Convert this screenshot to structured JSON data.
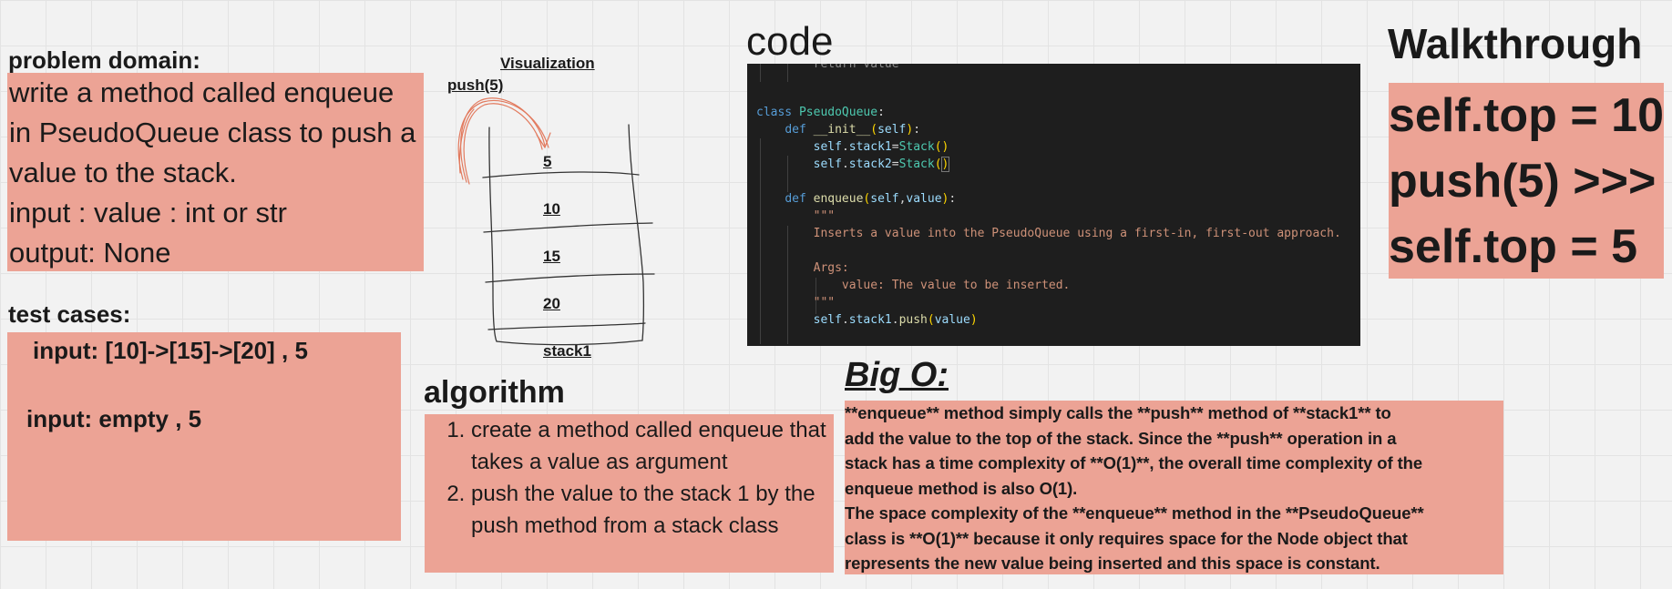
{
  "problem_domain": {
    "title": "problem domain:",
    "lines": [
      "write a method called enqueue",
      "in PseudoQueue class to push a",
      "value to the stack.",
      "input : value : int or str",
      "output: None"
    ]
  },
  "test_cases": {
    "title": "test cases:",
    "cases": [
      "input: [10]->[15]->[20] , 5",
      "input: empty , 5"
    ]
  },
  "visualization": {
    "title": "Visualization",
    "push_label": "push(5)",
    "stack_values": [
      "5",
      "10",
      "15",
      "20"
    ],
    "stack_name": "stack1"
  },
  "algorithm": {
    "title": "algorithm",
    "steps": [
      "create a method called enqueue that takes a value as argument",
      "push the value to the stack 1 by the push method from a stack class"
    ]
  },
  "code": {
    "title": "code",
    "lines": [
      "        return value",
      "",
      "",
      "class PseudoQueue:",
      "    def __init__(self):",
      "        self.stack1=Stack()",
      "        self.stack2=Stack()",
      "",
      "    def enqueue(self,value):",
      "        \"\"\"",
      "        Inserts a value into the PseudoQueue using a first-in, first-out approach.",
      "",
      "        Args:",
      "            value: The value to be inserted.",
      "        \"\"\"",
      "        self.stack1.push(value)"
    ]
  },
  "big_o": {
    "title": "Big O:",
    "lines": [
      "**enqueue** method simply calls the **push** method of **stack1** to",
      "add the value to the top of the stack. Since the **push** operation in a",
      "stack has a time complexity of **O(1)**, the overall time complexity of the",
      "enqueue method is also O(1).",
      "The space complexity of the **enqueue** method in the **PseudoQueue**",
      "class is **O(1)** because it only requires space for the Node object that",
      "represents the new value being inserted and this space is constant."
    ]
  },
  "walkthrough": {
    "title": "Walkthrough",
    "lines": [
      "self.top = 10",
      "push(5) >>>",
      "self.top = 5"
    ]
  },
  "colors": {
    "note_background": "#eca395",
    "canvas_background": "#f2f2f2",
    "code_background": "#1e1e1e"
  }
}
